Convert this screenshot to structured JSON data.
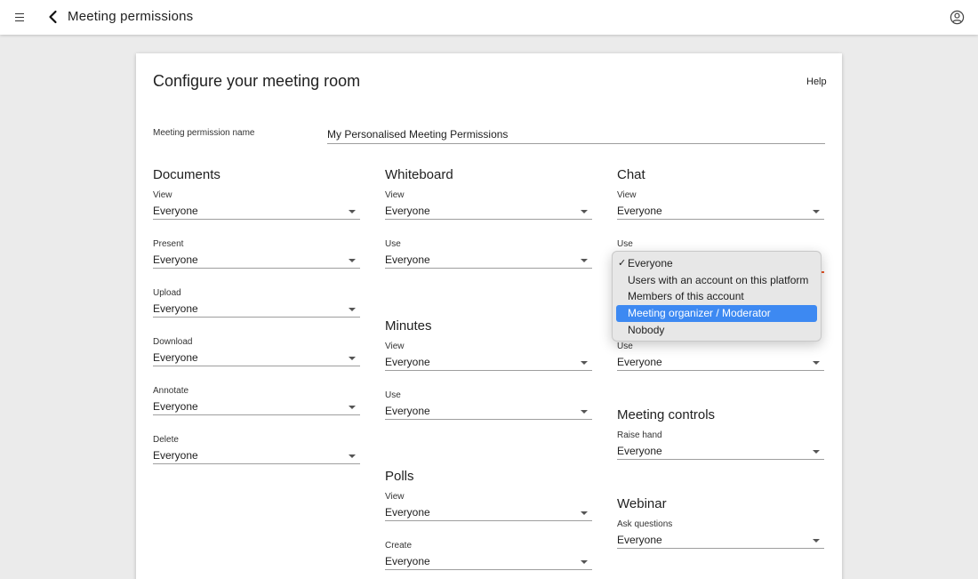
{
  "header": {
    "title": "Meeting permissions",
    "icons": {
      "menu": "menu-icon",
      "back": "chevron-left-icon",
      "account": "account-circle-icon"
    }
  },
  "card": {
    "title": "Configure your meeting room",
    "help_label": "Help",
    "permission_name_label": "Meeting permission name",
    "permission_name_value": "My Personalised Meeting Permissions"
  },
  "documents": {
    "title": "Documents",
    "fields": [
      {
        "label": "View",
        "value": "Everyone"
      },
      {
        "label": "Present",
        "value": "Everyone"
      },
      {
        "label": "Upload",
        "value": "Everyone"
      },
      {
        "label": "Download",
        "value": "Everyone"
      },
      {
        "label": "Annotate",
        "value": "Everyone"
      },
      {
        "label": "Delete",
        "value": "Everyone"
      }
    ]
  },
  "whiteboard": {
    "title": "Whiteboard",
    "fields": [
      {
        "label": "View",
        "value": "Everyone"
      },
      {
        "label": "Use",
        "value": "Everyone"
      }
    ]
  },
  "minutes": {
    "title": "Minutes",
    "fields": [
      {
        "label": "View",
        "value": "Everyone"
      },
      {
        "label": "Use",
        "value": "Everyone"
      }
    ]
  },
  "polls": {
    "title": "Polls",
    "fields": [
      {
        "label": "View",
        "value": "Everyone"
      },
      {
        "label": "Create",
        "value": "Everyone"
      }
    ]
  },
  "chat": {
    "title": "Chat",
    "fields": [
      {
        "label": "View",
        "value": "Everyone"
      },
      {
        "label": "Use",
        "value": "Everyone"
      }
    ]
  },
  "hidden_section": {
    "fields": [
      {
        "label": "Use",
        "value": "Everyone"
      }
    ]
  },
  "meeting_controls": {
    "title": "Meeting controls",
    "fields": [
      {
        "label": "Raise hand",
        "value": "Everyone"
      }
    ]
  },
  "webinar": {
    "title": "Webinar",
    "fields": [
      {
        "label": "Ask questions",
        "value": "Everyone"
      }
    ]
  },
  "dropdown": {
    "check_mark": "✓",
    "options": [
      "Everyone",
      "Users with an account on this platform",
      "Members of this account",
      "Meeting organizer / Moderator",
      "Nobody"
    ],
    "current": "Everyone",
    "highlighted": "Meeting organizer / Moderator"
  },
  "colors": {
    "accent_underline": "#e8572a",
    "highlight": "#3d89f2",
    "background": "#ebebeb"
  }
}
